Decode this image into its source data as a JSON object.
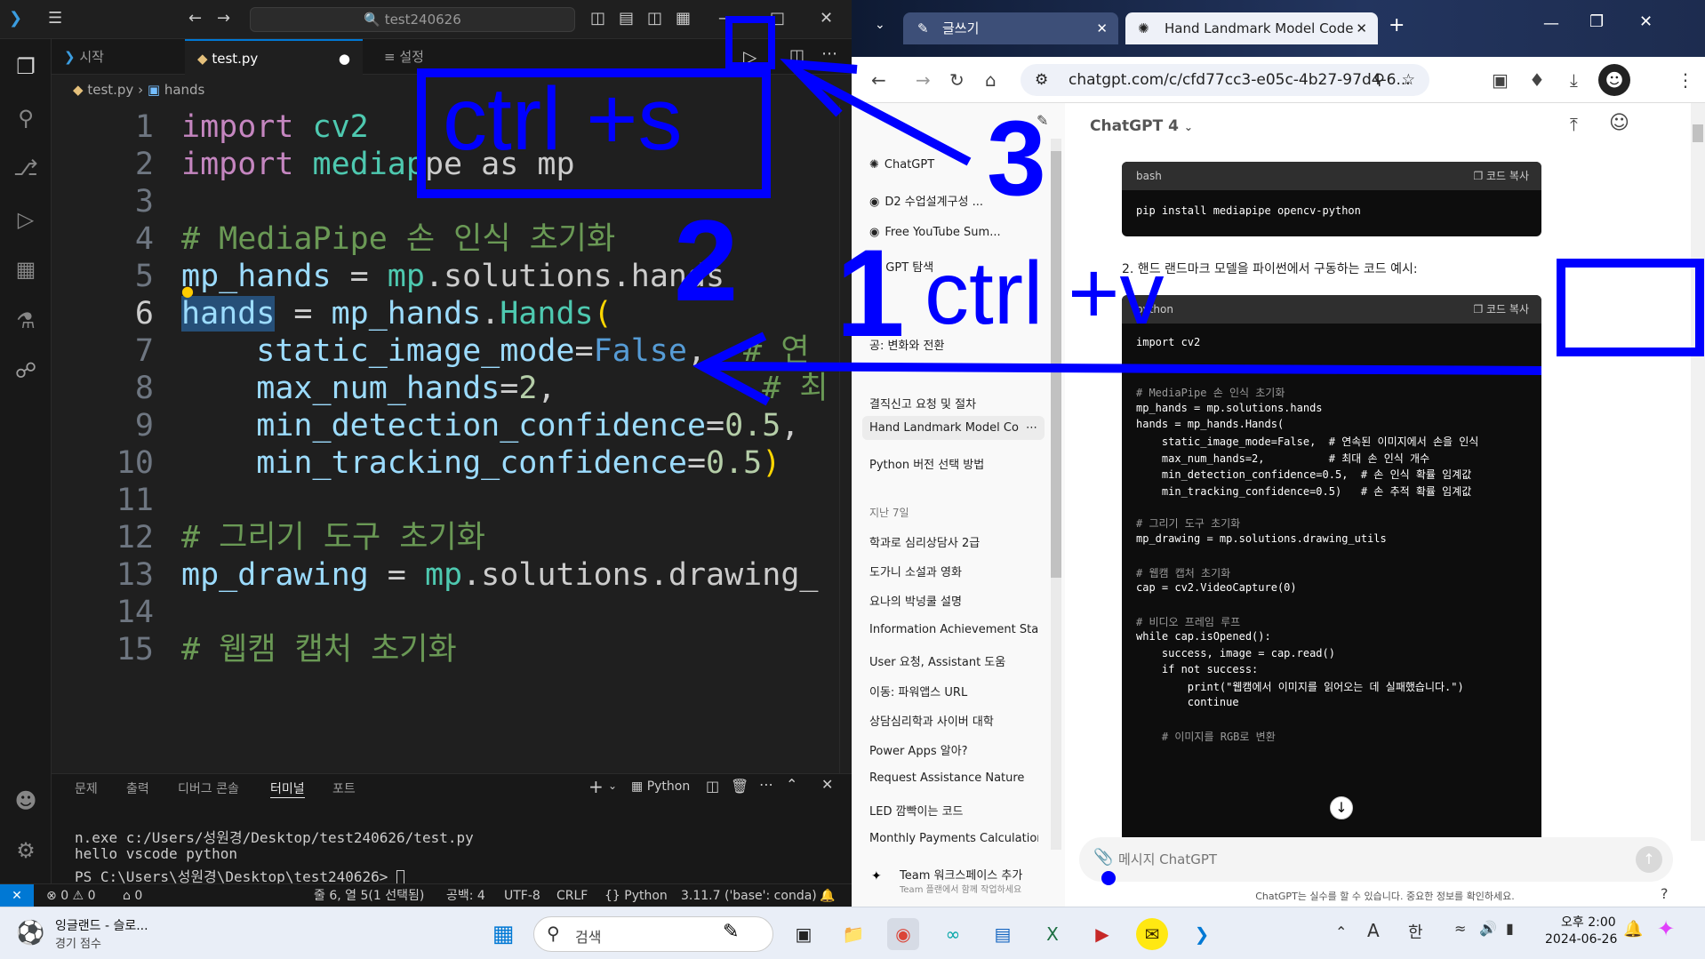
{
  "vscode": {
    "search": "test240626",
    "tabs": [
      {
        "label": "시작"
      },
      {
        "label": "test.py"
      },
      {
        "label": "설정"
      }
    ],
    "breadcrumb": {
      "file": "test.py",
      "symbol": "hands"
    },
    "code_lines": [
      {
        "n": "1",
        "html_key": "l1"
      },
      {
        "n": "2"
      },
      {
        "n": "3"
      },
      {
        "n": "4"
      },
      {
        "n": "5"
      },
      {
        "n": "6"
      },
      {
        "n": "7"
      },
      {
        "n": "8"
      },
      {
        "n": "9"
      },
      {
        "n": "10"
      },
      {
        "n": "11"
      },
      {
        "n": "12"
      },
      {
        "n": "13"
      },
      {
        "n": "14"
      },
      {
        "n": "15"
      }
    ],
    "code": {
      "l1a": "import",
      "l1b": " cv2",
      "l2a": "import",
      "l2b": " mediap",
      "l2c": "pe as mp",
      "l4": "# MediaPipe 손 인식 초기화",
      "l5a": "mp_hands",
      "l5b": " = ",
      "l5c": "mp",
      "l5d": ".solutions.hands",
      "l6a": "hands",
      "l6b": " = ",
      "l6c": "mp_hands",
      "l6d": ".",
      "l6e": "Hands",
      "l6f": "(",
      "l7a": "    static_image_mode",
      "l7b": "=",
      "l7c": "False",
      "l7d": ",  ",
      "l7e": "# 연",
      "l8a": "    max_num_hands",
      "l8b": "=",
      "l8c": "2",
      "l8d": ",",
      "l8e": "           # 최",
      "l9a": "    min_detection_confidence",
      "l9b": "=",
      "l9c": "0.5",
      "l9d": ",",
      "l10a": "    min_tracking_confidence",
      "l10b": "=",
      "l10c": "0.5",
      "l10d": ")",
      "l12": "# 그리기 도구 초기화",
      "l13a": "mp_drawing",
      "l13b": " = ",
      "l13c": "mp",
      "l13d": ".solutions.drawing_",
      "l15": "# 웹캠 캡처 초기화"
    },
    "panel_tabs": [
      "문제",
      "출력",
      "디버그 콘솔",
      "터미널",
      "포트"
    ],
    "terminal_profile": "Python",
    "terminal": [
      "n.exe c:/Users/성원경/Desktop/test240626/test.py",
      "hello vscode python",
      "PS C:\\Users\\성원경\\Desktop\\test240626> "
    ],
    "status": {
      "errors": "0",
      "warnings": "0",
      "ports": "0",
      "position": "줄 6, 열 5(1 선택됨)",
      "spaces": "공백: 4",
      "encoding": "UTF-8",
      "eol": "CRLF",
      "language": "Python",
      "interpreter": "3.11.7 ('base': conda)"
    }
  },
  "chrome": {
    "tabs": [
      {
        "label": "글쓰기"
      },
      {
        "label": "Hand Landmark Model Code"
      }
    ],
    "url": "chatgpt.com/c/cfd77cc3-e05c-4b27-97d4-6...",
    "model": "ChatGPT 4",
    "sidebar": {
      "top_items": [
        "ChatGPT",
        "D2 수업설계구성 ...",
        "Free YouTube Sum...",
        "GPT 탐색"
      ],
      "partial_item": "공: 변화와 전환",
      "items": [
        "결직신고 요청 및 절차",
        "Hand Landmark Model Co",
        "Python 버전 선택 방법"
      ],
      "section": "지난 7일",
      "items7": [
        "학과로 심리상담사 2급",
        "도가니 소설과 영화",
        "요나의 박넝쿨 설명",
        "Information Achievement Stan",
        "User 요청, Assistant 도움",
        "이동: 파워앱스 URL",
        "상담심리학과 사이버 대학",
        "Power Apps 알아?",
        "Request Assistance Nature",
        "LED 깜빡이는 코드",
        "Monthly Payments Calculation"
      ],
      "team_title": "Team 워크스페이스 추가",
      "team_sub": "Team 플랜에서 함께 작업하세요"
    },
    "bash_block": {
      "lang": "bash",
      "copy": "코드 복사",
      "code": "pip install mediapipe opencv-python"
    },
    "step2": "2.  핸드 랜드마크 모델을 파이썬에서 구동하는 코드 예시:",
    "python_block": {
      "lang": "python",
      "copy": "코드 복사",
      "lines": [
        "import cv2",
        "",
        "",
        "# MediaPipe 손 인식 초기화",
        "mp_hands = mp.solutions.hands",
        "hands = mp_hands.Hands(",
        "    static_image_mode=False,  # 연속된 이미지에서 손을 인식",
        "    max_num_hands=2,          # 최대 손 인식 개수",
        "    min_detection_confidence=0.5,  # 손 인식 확률 임계값",
        "    min_tracking_confidence=0.5)   # 손 추적 확률 임계값",
        "",
        "# 그리기 도구 초기화",
        "mp_drawing = mp.solutions.drawing_utils",
        "",
        "# 웹캠 캡처 초기화",
        "cap = cv2.VideoCapture(0)",
        "",
        "# 비디오 프레임 루프",
        "while cap.isOpened():",
        "    success, image = cap.read()",
        "    if not success:",
        "        print(\"웹캠에서 이미지를 읽어오는 데 실패했습니다.\")",
        "        continue",
        "",
        "    # 이미지를 RGB로 변환"
      ]
    },
    "composer_placeholder": "메시지 ChatGPT",
    "disclaimer": "ChatGPT는 실수를 할 수 있습니다. 중요한 정보를 확인하세요."
  },
  "annotations": {
    "ctrl_s": "ctrl +s",
    "ctrl_v": "ctrl +v",
    "n1": "1",
    "n2": "2",
    "n3": "3"
  },
  "taskbar": {
    "news_title": "잉글랜드 - 슬로...",
    "news_sub": "경기 점수",
    "search": "검색",
    "lang": "A",
    "ime": "한",
    "time": "오후 2:00",
    "date": "2024-06-26"
  },
  "colors": {
    "annotation": "#0000ff",
    "accent": "#0078d4",
    "chrome_tab": "#23355f"
  }
}
